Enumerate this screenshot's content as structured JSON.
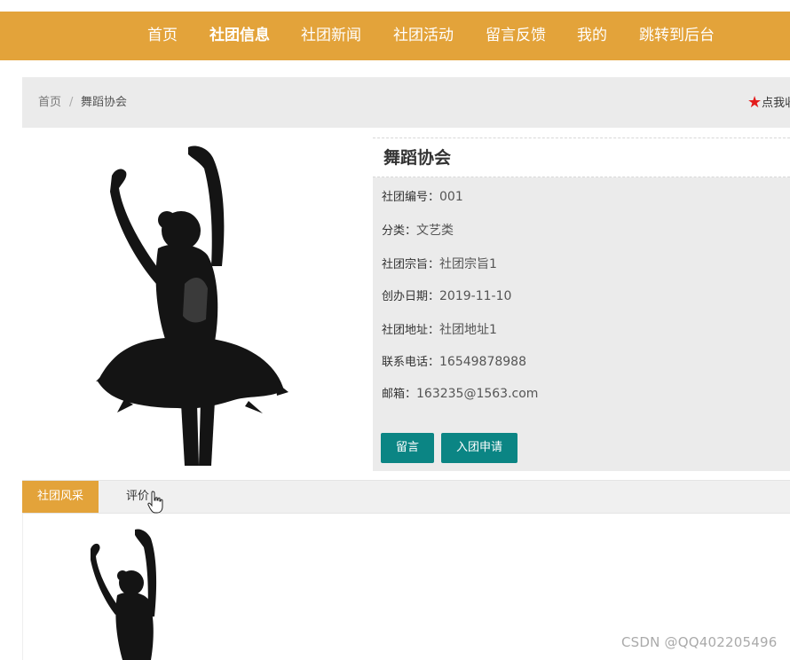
{
  "nav": {
    "items": [
      {
        "label": "首页"
      },
      {
        "label": "社团信息"
      },
      {
        "label": "社团新闻"
      },
      {
        "label": "社团活动"
      },
      {
        "label": "留言反馈"
      },
      {
        "label": "我的"
      },
      {
        "label": "跳转到后台"
      }
    ],
    "active": "社团信息",
    "bg_color": "#e3a33a"
  },
  "breadcrumb": {
    "home": "首页",
    "separator": "/",
    "current": "舞蹈协会"
  },
  "favorite": {
    "label": "点我收"
  },
  "club": {
    "name": "舞蹈协会",
    "fields": [
      {
        "label": "社团编号：",
        "value": "001"
      },
      {
        "label": "分类：",
        "value": "文艺类"
      },
      {
        "label": "社团宗旨：",
        "value": "社团宗旨1"
      },
      {
        "label": "创办日期：",
        "value": "2019-11-10"
      },
      {
        "label": "社团地址：",
        "value": "社团地址1"
      },
      {
        "label": "联系电话：",
        "value": "16549878988"
      },
      {
        "label": "邮箱：",
        "value": "163235@1563.com"
      }
    ]
  },
  "actions": {
    "message": "留言",
    "join": "入团申请",
    "color": "#0b8584"
  },
  "tabs": [
    {
      "label": "社团风采",
      "active": true
    },
    {
      "label": "评价",
      "active": false
    }
  ],
  "watermark": "CSDN @QQ402205496"
}
